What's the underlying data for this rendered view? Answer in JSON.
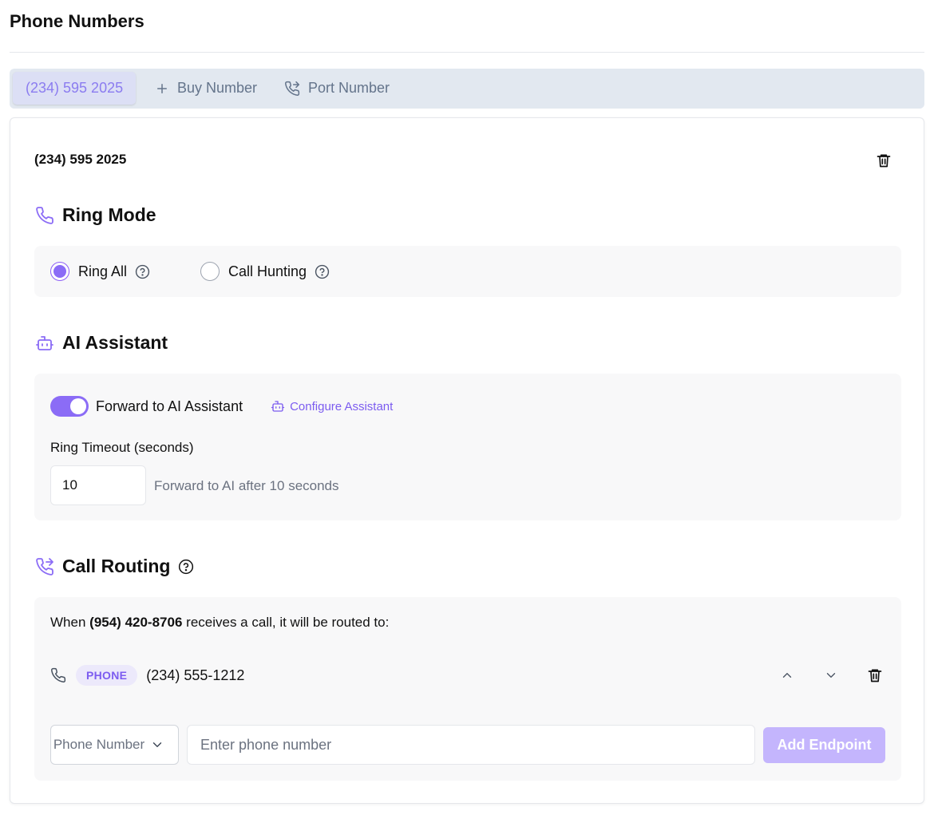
{
  "page": {
    "title": "Phone Numbers"
  },
  "tabs": {
    "active_number": "(234) 595 2025",
    "buy_label": "Buy Number",
    "port_label": "Port Number"
  },
  "number_detail": {
    "heading": "(234) 595 2025",
    "ring_mode": {
      "title": "Ring Mode",
      "options": [
        {
          "label": "Ring All",
          "selected": true
        },
        {
          "label": "Call Hunting",
          "selected": false
        }
      ]
    },
    "ai_assistant": {
      "title": "AI Assistant",
      "forward_label": "Forward to AI Assistant",
      "forward_enabled": true,
      "configure_label": "Configure Assistant",
      "ring_timeout_label": "Ring Timeout (seconds)",
      "ring_timeout_value": "10",
      "ring_timeout_hint": "Forward to AI after 10 seconds"
    },
    "call_routing": {
      "title": "Call Routing",
      "route_prefix": "When",
      "route_number": "(954) 420-8706",
      "route_suffix": "receives a call, it will be routed to:",
      "endpoints": [
        {
          "type": "PHONE",
          "number": "(234) 555-1212"
        }
      ],
      "new_endpoint": {
        "type_selected": "Phone Number",
        "placeholder": "Enter phone number",
        "add_label": "Add Endpoint"
      }
    }
  },
  "colors": {
    "accent": "#8b6cf6",
    "accent_light": "#c4b5fd",
    "tabbar": "#e2e8f0",
    "panel": "#f8f8f9"
  },
  "icons": [
    "plus-icon",
    "phone-forward-icon",
    "trash-icon",
    "phone-icon",
    "help-icon",
    "bot-icon",
    "chevron-up-icon",
    "chevron-down-icon"
  ]
}
